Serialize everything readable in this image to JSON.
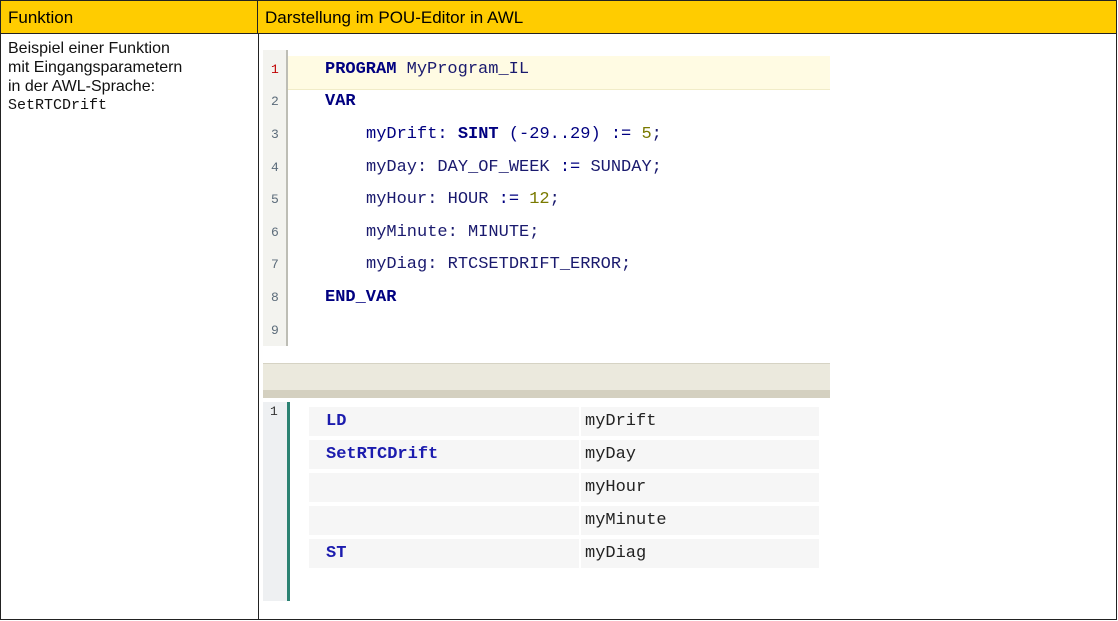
{
  "table": {
    "header": {
      "col1": "Funktion",
      "col2": "Darstellung im POU-Editor in AWL"
    },
    "description": {
      "line1": "Beispiel einer Funktion",
      "line2": "mit Eingangsparametern",
      "line3": "in der AWL-Sprache:",
      "function_name": "SetRTCDrift"
    }
  },
  "declaration_editor": {
    "line_numbers": [
      "1",
      "2",
      "3",
      "4",
      "5",
      "6",
      "7",
      "8",
      "9"
    ],
    "line1": {
      "kw": "PROGRAM",
      "text": " MyProgram_IL"
    },
    "line2": {
      "kw": "VAR"
    },
    "line3": {
      "name": "myDrift:",
      "type": "SINT",
      "range": " (-29..29) ",
      "assign": ":=",
      "value": " 5",
      "end": ";"
    },
    "line4": {
      "name": "myDay: DAY_OF_WEEK ",
      "assign": ":=",
      "value": " SUNDAY",
      "end": ";"
    },
    "line5": {
      "name": "myHour: HOUR ",
      "assign": ":=",
      "value": " 12",
      "end": ";"
    },
    "line6": {
      "text": "myMinute: MINUTE;"
    },
    "line7": {
      "text": "myDiag: RTCSETDRIFT_ERROR;"
    },
    "line8": {
      "kw": "END_VAR"
    }
  },
  "il_editor": {
    "line_number": "1",
    "rows": [
      {
        "operator": "LD",
        "operand": "myDrift"
      },
      {
        "operator": "SetRTCDrift",
        "operand": "myDay"
      },
      {
        "operator": "",
        "operand": "myHour"
      },
      {
        "operator": "",
        "operand": "myMinute"
      },
      {
        "operator": "ST",
        "operand": "myDiag"
      }
    ]
  },
  "colors": {
    "header_bg": "#ffcc00",
    "keyword": "#000080",
    "il_operator": "#1c1cae",
    "gutter_accent": "#2c8273"
  }
}
